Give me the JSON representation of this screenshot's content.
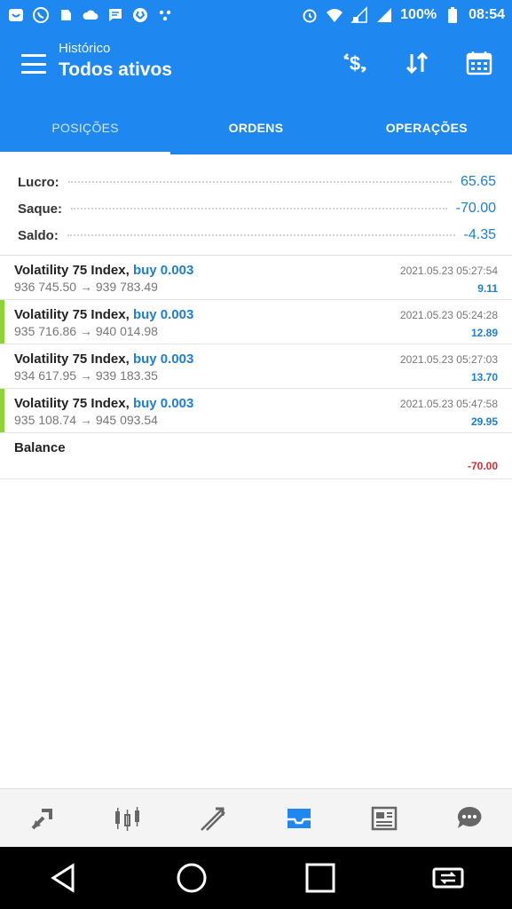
{
  "status_bar": {
    "battery": "100%",
    "time": "08:54"
  },
  "header": {
    "subtitle": "Histórico",
    "title": "Todos ativos"
  },
  "tabs": [
    {
      "label": "POSIÇÕES"
    },
    {
      "label": "ORDENS"
    },
    {
      "label": "OPERAÇÕES"
    }
  ],
  "summary": {
    "profit_label": "Lucro:",
    "profit_value": "65.65",
    "withdraw_label": "Saque:",
    "withdraw_value": "-70.00",
    "balance_label": "Saldo:",
    "balance_value": "-4.35"
  },
  "deals": [
    {
      "symbol": "Volatility 75 Index,",
      "side": "buy 0.003",
      "prices": "936 745.50 → 939 783.49",
      "time": "2021.05.23 05:27:54",
      "profit": "9.11"
    },
    {
      "symbol": "Volatility 75 Index,",
      "side": "buy 0.003",
      "prices": "935 716.86 → 940 014.98",
      "time": "2021.05.23 05:24:28",
      "profit": "12.89"
    },
    {
      "symbol": "Volatility 75 Index,",
      "side": "buy 0.003",
      "prices": "934 617.95 → 939 183.35",
      "time": "2021.05.23 05:27:03",
      "profit": "13.70"
    },
    {
      "symbol": "Volatility 75 Index,",
      "side": "buy 0.003",
      "prices": "935 108.74 → 945 093.54",
      "time": "2021.05.23 05:47:58",
      "profit": "29.95"
    }
  ],
  "balance_row": {
    "label": "Balance",
    "value": "-70.00"
  },
  "colors": {
    "primary": "#1e88f0",
    "marker": "#8fd33b",
    "negative": "#d32f2f"
  }
}
